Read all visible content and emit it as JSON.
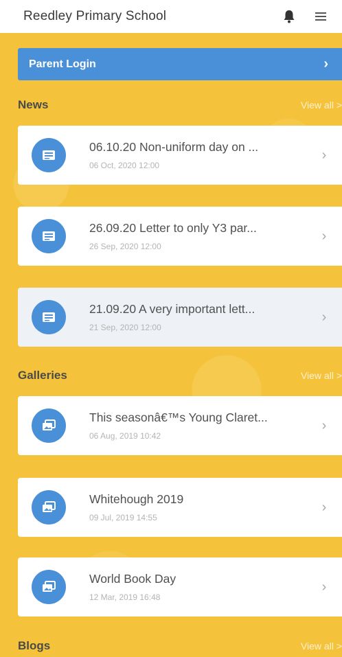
{
  "header": {
    "title": "Reedley Primary School",
    "bell_icon": "bell-icon",
    "menu_icon": "hamburger-menu-icon"
  },
  "login": {
    "label": "Parent Login",
    "chevron": "›"
  },
  "sections": {
    "news": {
      "title": "News",
      "view_all": "View all >",
      "items": [
        {
          "title": "06.10.20 Non-uniform day on ...",
          "date": "06 Oct, 2020 12:00",
          "icon": "news-icon"
        },
        {
          "title": "26.09.20 Letter to only Y3 par...",
          "date": "26 Sep, 2020 12:00",
          "icon": "news-icon"
        },
        {
          "title": "21.09.20 A very important lett...",
          "date": "21 Sep, 2020 12:00",
          "icon": "news-icon"
        }
      ]
    },
    "galleries": {
      "title": "Galleries",
      "view_all": "View all >",
      "items": [
        {
          "title": "This seasonâ€™s Young Claret...",
          "date": "06 Aug, 2019 10:42",
          "icon": "gallery-icon"
        },
        {
          "title": "Whitehough 2019",
          "date": "09 Jul, 2019 14:55",
          "icon": "gallery-icon"
        },
        {
          "title": "World Book Day",
          "date": "12 Mar, 2019 16:48",
          "icon": "gallery-icon"
        }
      ]
    },
    "blogs": {
      "title": "Blogs",
      "view_all": "View all >"
    }
  },
  "chevron": "›",
  "colors": {
    "background": "#f5c33b",
    "accent": "#4a90d9",
    "card": "#ffffff",
    "header_bg": "#ffffff"
  }
}
